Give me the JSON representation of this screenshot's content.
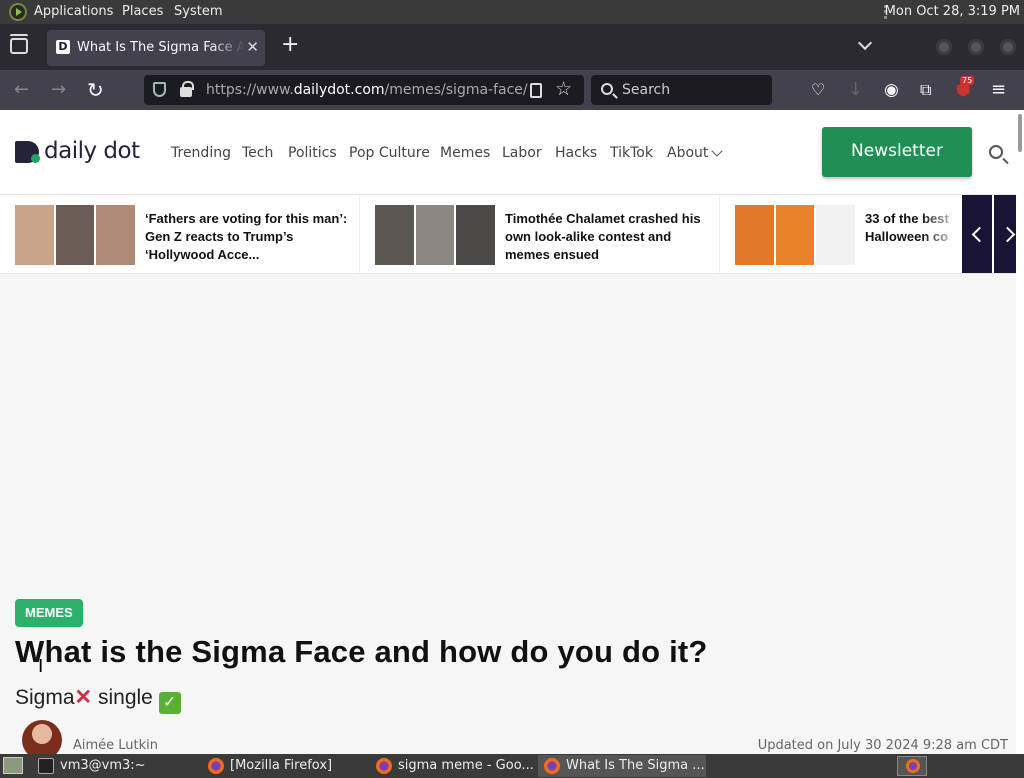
{
  "system_panel": {
    "menus": [
      "Applications",
      "Places",
      "System"
    ],
    "clock": "Mon Oct 28,  3:19 PM"
  },
  "browser": {
    "tab": {
      "title": "What Is The Sigma Face And How Do You Do It?",
      "favicon": "D"
    },
    "url_prefix": "https://www.",
    "url_domain": "dailydot.com",
    "url_path": "/memes/sigma-face/",
    "search_placeholder": "Search",
    "extension_badge": "75"
  },
  "site": {
    "logo_text": "daily dot",
    "nav": [
      "Trending",
      "Tech",
      "Politics",
      "Pop Culture",
      "Memes",
      "Labor",
      "Hacks",
      "TikTok",
      "About"
    ],
    "newsletter_label": "Newsletter",
    "brand_green": "#1f8f55",
    "carousel_bg": "#191336"
  },
  "trending": [
    {
      "title": "‘Fathers are voting for this man’: Gen Z reacts to Trump’s ‘Hollywood Acce...",
      "thumb_colors": [
        "#c9a488",
        "#6b5b55",
        "#b08a78"
      ]
    },
    {
      "title": "Timothée Chalamet crashed his own look-alike contest and memes ensued",
      "thumb_colors": [
        "#5a5750",
        "#8a8680",
        "#4c4a48"
      ]
    },
    {
      "title": "33 of the best Halloween co",
      "thumb_colors": [
        "#e07a2a",
        "#e8832c",
        "#f2f2f2"
      ]
    }
  ],
  "article": {
    "category": "MEMES",
    "headline": "What is the Sigma Face and how do you do it?",
    "subhead_word1": "Sigma",
    "subhead_x": "✕",
    "subhead_word2": " single ",
    "subhead_check": "✓",
    "author": "Aimée Lutkin",
    "updated": "Updated on July 30 2024 9:28 am CDT"
  },
  "taskbar": {
    "tasks": [
      "vm3@vm3:~",
      "[Mozilla Firefox]",
      "sigma meme - Goo...",
      "What Is The Sigma ..."
    ]
  }
}
